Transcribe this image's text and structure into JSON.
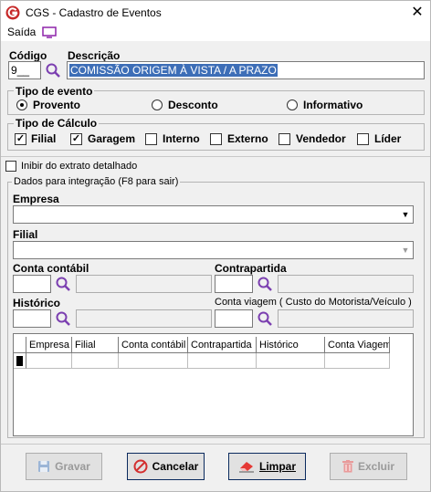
{
  "window": {
    "title": "CGS - Cadastro de Eventos",
    "close": "✕"
  },
  "menu": {
    "saida": "Saída"
  },
  "codigo": {
    "label": "Código",
    "value": "9"
  },
  "descricao": {
    "label": "Descrição",
    "value": "COMISSÃO ORIGEM À VISTA / A PRAZO"
  },
  "tipo_evento": {
    "title": "Tipo de evento",
    "options": [
      "Provento",
      "Desconto",
      "Informativo"
    ],
    "selected": "Provento"
  },
  "tipo_calculo": {
    "title": "Tipo de Cálculo",
    "options": [
      {
        "label": "Filial",
        "checked": true
      },
      {
        "label": "Garagem",
        "checked": true
      },
      {
        "label": "Interno",
        "checked": false
      },
      {
        "label": "Externo",
        "checked": false
      },
      {
        "label": "Vendedor",
        "checked": false
      },
      {
        "label": "Líder",
        "checked": false
      }
    ]
  },
  "inibir": {
    "label": "Inibir do extrato detalhado",
    "checked": false
  },
  "integracao": {
    "title": "Dados para integração  (F8 para sair)",
    "empresa_label": "Empresa",
    "filial_label": "Filial",
    "conta_contabil_label": "Conta contábil",
    "contrapartida_label": "Contrapartida",
    "historico_label": "Histórico",
    "conta_viagem_label": "Conta viagem ( Custo do Motorista/Veículo )"
  },
  "grid": {
    "columns": [
      "Empresa",
      "Filial",
      "Conta contábil",
      "Contrapartida",
      "Histórico",
      "Conta Viagem"
    ]
  },
  "buttons": {
    "gravar": "Gravar",
    "cancelar": "Cancelar",
    "limpar": "Limpar",
    "excluir": "Excluir"
  },
  "colors": {
    "accent": "#3d6eb7",
    "logo": "#c62828",
    "search": "#7b3fb0",
    "cancel": "#d32f2f"
  }
}
